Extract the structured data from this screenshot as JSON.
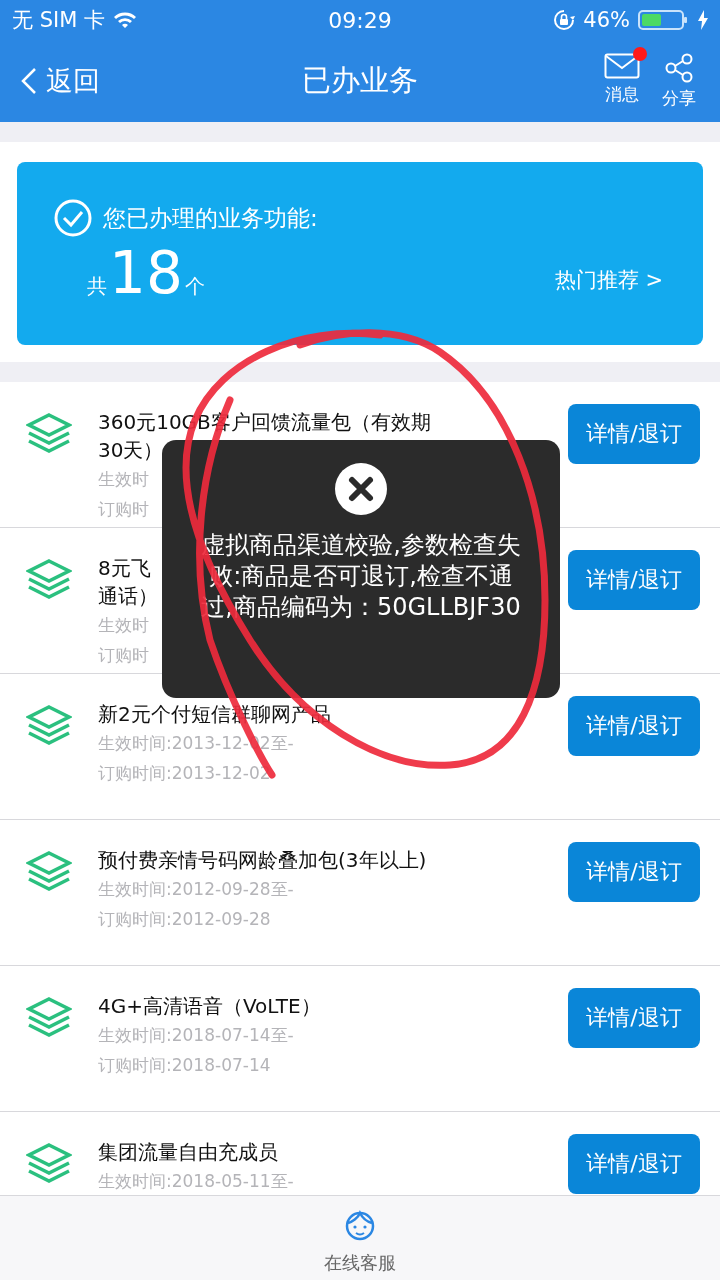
{
  "status_bar": {
    "carrier": "无 SIM 卡",
    "time": "09:29",
    "battery": "46%"
  },
  "nav": {
    "back": "返回",
    "title": "已办业务",
    "actions": [
      {
        "kind": "message",
        "label": "消息",
        "badge": true
      },
      {
        "kind": "share",
        "label": "分享",
        "badge": false
      }
    ]
  },
  "summary": {
    "heading": "您已办理的业务功能:",
    "count_prefix": "共",
    "count": "18",
    "count_suffix": "个",
    "link": "热门推荐 >"
  },
  "services": [
    {
      "title_lines": [
        "360元10GB客户回馈流量包（有效期",
        "30天）"
      ],
      "dates": [
        "生效时",
        "订购时"
      ],
      "button": "详情/退订"
    },
    {
      "title_lines": [
        "8元飞",
        "通话）"
      ],
      "dates": [
        "生效时",
        "订购时"
      ],
      "button": "详情/退订"
    },
    {
      "title_lines": [
        "新2元个付短信群聊网产品"
      ],
      "dates": [
        "生效时间:2013-12-02至-",
        "订购时间:2013-12-02"
      ],
      "button": "详情/退订"
    },
    {
      "title_lines": [
        "预付费亲情号码网龄叠加包(3年以上)"
      ],
      "dates": [
        "生效时间:2012-09-28至-",
        "订购时间:2012-09-28"
      ],
      "button": "详情/退订"
    },
    {
      "title_lines": [
        "4G+高清语音（VoLTE）"
      ],
      "dates": [
        "生效时间:2018-07-14至-",
        "订购时间:2018-07-14"
      ],
      "button": "详情/退订"
    },
    {
      "title_lines": [
        "集团流量自由充成员"
      ],
      "dates": [
        "生效时间:2018-05-11至-"
      ],
      "button": "详情/退订"
    }
  ],
  "toast": {
    "message": "虚拟商品渠道校验,参数检查失败:商品是否可退订,检查不通过,商品编码为：50GLLBJF30"
  },
  "bottom_bar": {
    "label": "在线客服"
  }
}
